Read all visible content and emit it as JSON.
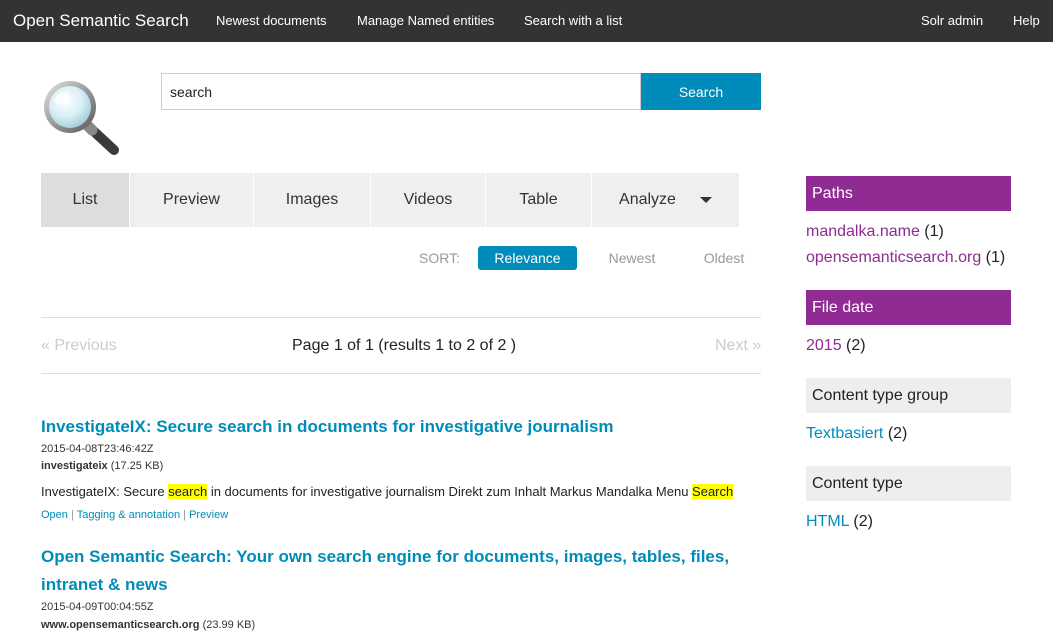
{
  "topbar": {
    "brand": "Open Semantic Search",
    "nav_left": [
      "Newest documents",
      "Manage Named entities",
      "Search with a list"
    ],
    "nav_right": [
      "Solr admin",
      "Help"
    ]
  },
  "search": {
    "value": "search",
    "button_label": "Search"
  },
  "tabs": [
    "List",
    "Preview",
    "Images",
    "Videos",
    "Table",
    "Analyze"
  ],
  "sort": {
    "label": "SORT:",
    "options": [
      "Relevance",
      "Newest",
      "Oldest"
    ],
    "selected": "Relevance"
  },
  "pager": {
    "prev": "« Previous",
    "info": "Page 1 of 1 (results 1 to 2 of 2 )",
    "next": "Next »"
  },
  "results": [
    {
      "title_line1": "InvestigateIX: Secure search in documents for investigative journalism",
      "title_line2": "",
      "date": "2015-04-08T23:46:42Z",
      "host": "investigateix",
      "size": "(17.25 KB)",
      "snippet_parts": [
        "InvestigateIX: Secure ",
        "search",
        " in documents for investigative journalism Direkt zum Inhalt Markus Mandalka Menu ",
        "Search"
      ],
      "actions": [
        "Open",
        "Tagging & annotation",
        "Preview"
      ]
    },
    {
      "title_line1": "Open Semantic Search: Your own search engine for documents, images, tables, files,",
      "title_line2": "intranet & news",
      "date": "2015-04-09T00:04:55Z",
      "host": "www.opensemanticsearch.org",
      "size": "(23.99 KB)"
    }
  ],
  "facets": {
    "paths": {
      "title": "Paths",
      "items": [
        {
          "label": "mandalka.name",
          "count": "(1)"
        },
        {
          "label": "opensemanticsearch.org",
          "count": "(1)"
        }
      ]
    },
    "file_date": {
      "title": "File date",
      "items": [
        {
          "label": "2015",
          "count": "(2)"
        }
      ]
    },
    "content_type_group": {
      "title": "Content type group",
      "items": [
        {
          "label": "Textbasiert",
          "count": "(2)"
        }
      ]
    },
    "content_type": {
      "title": "Content type",
      "items": [
        {
          "label": "HTML",
          "count": "(2)"
        }
      ]
    }
  },
  "colors": {
    "topbar": "#333333",
    "accent_blue": "#008cba",
    "facet_purple": "#8f2b92",
    "highlight": "#ffff00"
  },
  "icons": [
    "magnifier-logo-icon",
    "caret-down-icon"
  ]
}
